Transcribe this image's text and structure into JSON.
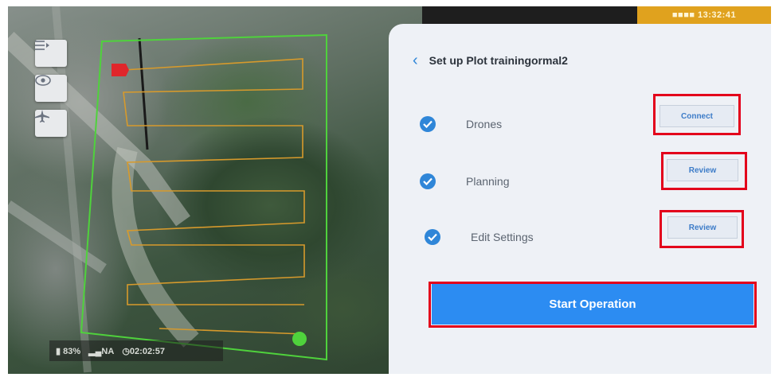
{
  "map": {
    "buttons": [
      {
        "icon": "list-view-icon"
      },
      {
        "icon": "eye-icon"
      },
      {
        "icon": "airplane-icon"
      }
    ],
    "status": {
      "battery": "83%",
      "signal": "NA",
      "timer": "02:02:57"
    }
  },
  "panel": {
    "clock": "■■■■ 13:32:41",
    "back_icon": "‹",
    "title": "Set up Plot trainingormal2",
    "steps": [
      {
        "label": "Drones",
        "button": "Connect"
      },
      {
        "label": "Planning",
        "button": "Review"
      },
      {
        "label": "Edit Settings",
        "button": "Review"
      }
    ],
    "start_button": "Start Operation"
  },
  "colors": {
    "accent": "#2c8cf2",
    "check": "#2f86d8",
    "highlight": "#e3001b",
    "flight_path": "#d79a2c",
    "boundary": "#4fd23c",
    "clock_bg": "#e0a21e"
  }
}
